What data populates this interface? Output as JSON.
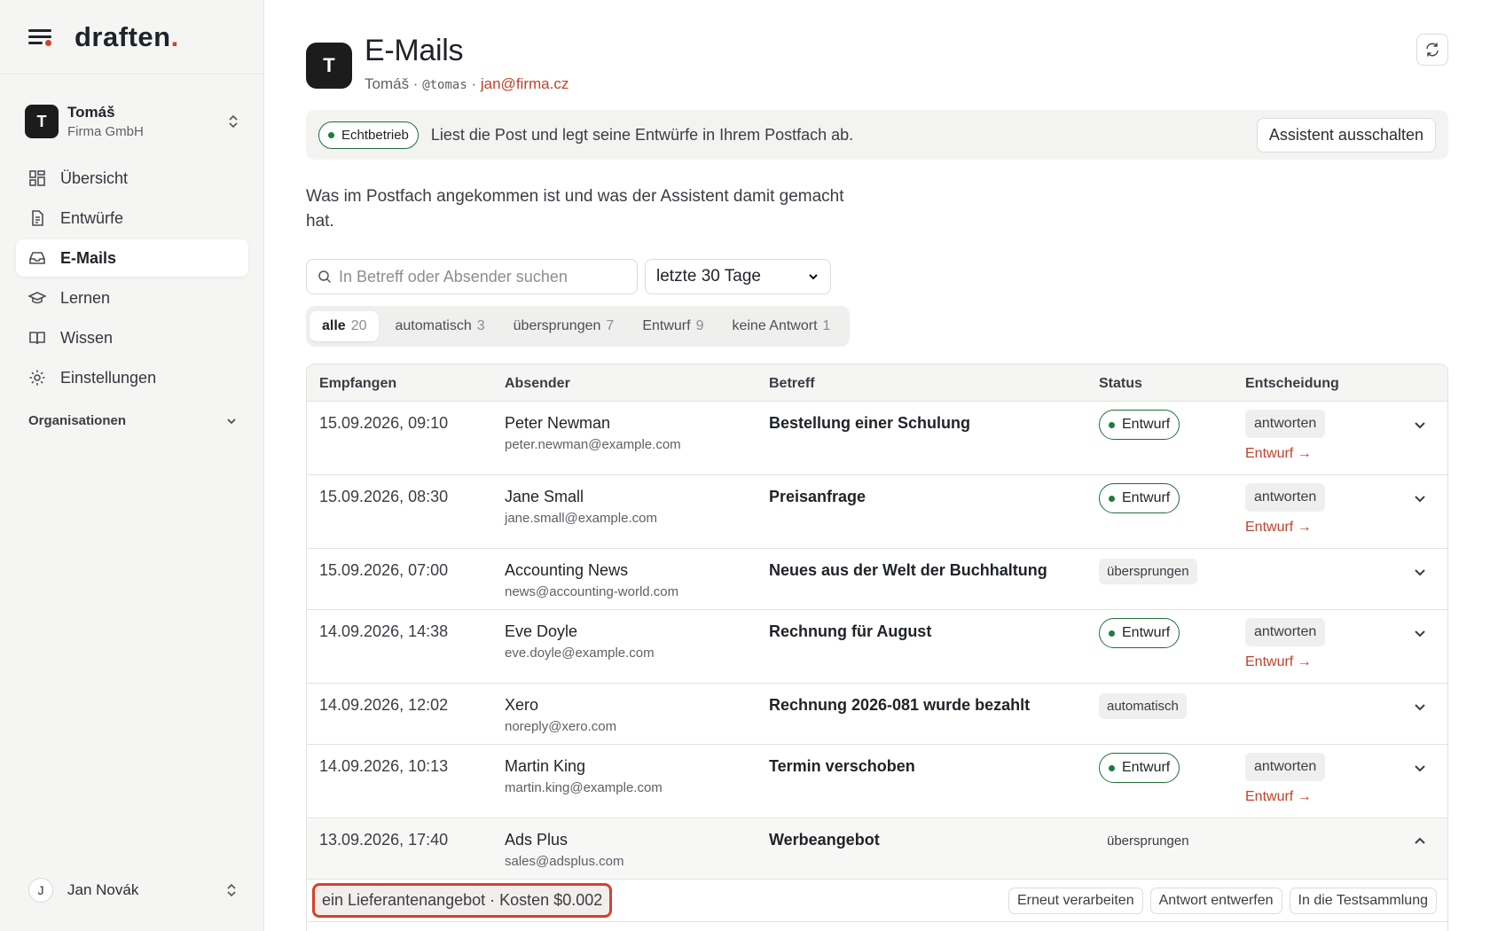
{
  "brand": {
    "name": "draften",
    "dot": "."
  },
  "account": {
    "initial": "T",
    "name": "Tomáš",
    "org": "Firma GmbH"
  },
  "nav": {
    "items": [
      {
        "label": "Übersicht"
      },
      {
        "label": "Entwürfe"
      },
      {
        "label": "E-Mails"
      },
      {
        "label": "Lernen"
      },
      {
        "label": "Wissen"
      },
      {
        "label": "Einstellungen"
      }
    ],
    "section": "Organisationen"
  },
  "user": {
    "initial": "J",
    "name": "Jan Novák"
  },
  "header": {
    "initial": "T",
    "title": "E-Mails",
    "name": "Tomáš",
    "sep1": " · ",
    "handle": "@tomas",
    "sep2": " · ",
    "email": "jan@firma.cz"
  },
  "banner": {
    "status": "Echtbetrieb",
    "text": "Liest die Post und legt seine Entwürfe in Ihrem Postfach ab.",
    "button": "Assistent ausschalten"
  },
  "intro": "Was im Postfach angekommen ist und was der Assistent damit gemacht hat.",
  "search": {
    "placeholder": "In Betreff oder Absender suchen"
  },
  "period": {
    "selected": "letzte 30 Tage"
  },
  "filters": [
    {
      "label": "alle",
      "count": "20"
    },
    {
      "label": "automatisch",
      "count": "3"
    },
    {
      "label": "übersprungen",
      "count": "7"
    },
    {
      "label": "Entwurf",
      "count": "9"
    },
    {
      "label": "keine Antwort",
      "count": "1"
    }
  ],
  "table": {
    "headers": {
      "received": "Empfangen",
      "sender": "Absender",
      "subject": "Betreff",
      "status": "Status",
      "decision": "Entscheidung"
    },
    "rows": [
      {
        "date": "15.09.2026, 09:10",
        "name": "Peter Newman",
        "email": "peter.newman@example.com",
        "subject": "Bestellung einer Schulung",
        "status": "Entwurf",
        "decision": "antworten",
        "link": "Entwurf →"
      },
      {
        "date": "15.09.2026, 08:30",
        "name": "Jane Small",
        "email": "jane.small@example.com",
        "subject": "Preisanfrage",
        "status": "Entwurf",
        "decision": "antworten",
        "link": "Entwurf →"
      },
      {
        "date": "15.09.2026, 07:00",
        "name": "Accounting News",
        "email": "news@accounting-world.com",
        "subject": "Neues aus der Welt der Buchhaltung",
        "status": "übersprungen"
      },
      {
        "date": "14.09.2026, 14:38",
        "name": "Eve Doyle",
        "email": "eve.doyle@example.com",
        "subject": "Rechnung für August",
        "status": "Entwurf",
        "decision": "antworten",
        "link": "Entwurf →"
      },
      {
        "date": "14.09.2026, 12:02",
        "name": "Xero",
        "email": "noreply@xero.com",
        "subject": "Rechnung 2026-081 wurde bezahlt",
        "status": "automatisch"
      },
      {
        "date": "14.09.2026, 10:13",
        "name": "Martin King",
        "email": "martin.king@example.com",
        "subject": "Termin verschoben",
        "status": "Entwurf",
        "decision": "antworten",
        "link": "Entwurf →"
      },
      {
        "date": "13.09.2026, 17:40",
        "name": "Ads Plus",
        "email": "sales@adsplus.com",
        "subject": "Werbeangebot",
        "status": "übersprungen"
      }
    ],
    "detail": {
      "summary": "ein Lieferantenangebot · Kosten $0.002",
      "actions": [
        "Erneut verarbeiten",
        "Antwort entwerfen",
        "In die Testsammlung"
      ]
    }
  },
  "colors": {
    "accent": "#d6412a",
    "link": "#c2412b",
    "live": "#1f7a3f"
  }
}
